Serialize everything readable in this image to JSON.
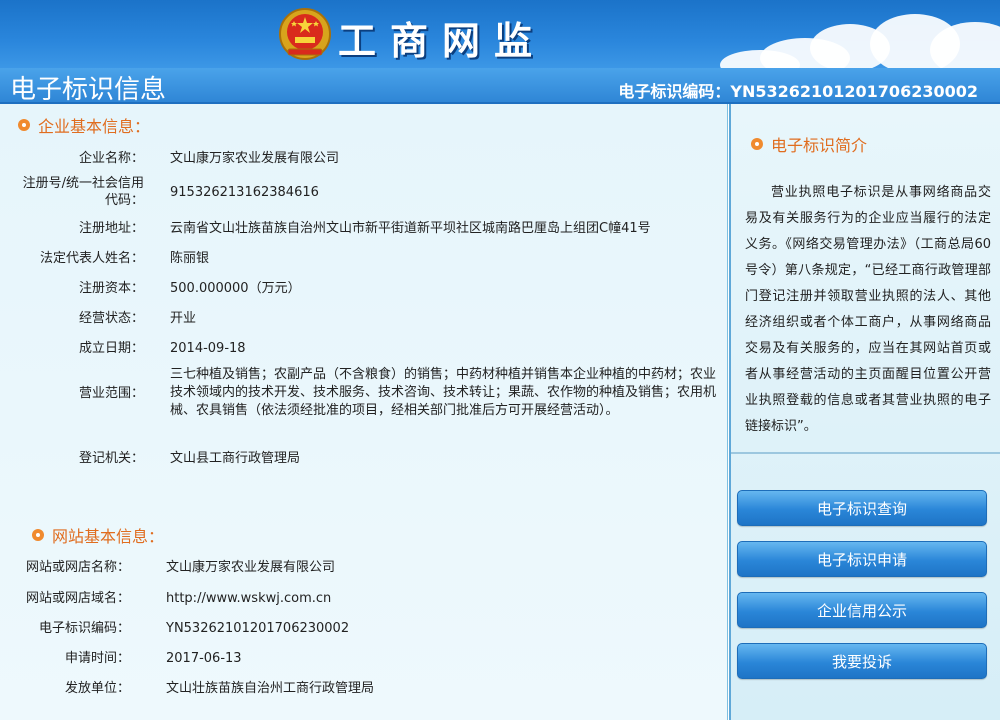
{
  "header": {
    "brand": "工商网监"
  },
  "titlebar": {
    "title": "电子标识信息",
    "code_text": "电子标识编码：YN53262101201706230002"
  },
  "enterprise": {
    "heading": "企业基本信息：",
    "rows": [
      {
        "label": "企业名称：",
        "value": "文山康万家农业发展有限公司"
      },
      {
        "label": "注册号/统一社会信用代码：",
        "value": "915326213162384616"
      },
      {
        "label": "注册地址：",
        "value": "云南省文山壮族苗族自治州文山市新平街道新平坝社区城南路巴厘岛上组团C幢41号"
      },
      {
        "label": "法定代表人姓名：",
        "value": "陈丽银"
      },
      {
        "label": "注册资本：",
        "value": "500.000000（万元）"
      },
      {
        "label": "经营状态：",
        "value": "开业"
      },
      {
        "label": "成立日期：",
        "value": "2014-09-18"
      },
      {
        "label": "营业范围：",
        "value": "三七种植及销售；农副产品（不含粮食）的销售；中药材种植并销售本企业种植的中药材；农业技术领域内的技术开发、技术服务、技术咨询、技术转让；果蔬、农作物的种植及销售；农用机械、农具销售（依法须经批准的项目，经相关部门批准后方可开展经营活动）。"
      },
      {
        "label": "登记机关：",
        "value": "文山县工商行政管理局"
      }
    ]
  },
  "website": {
    "heading": "网站基本信息：",
    "rows": [
      {
        "label": "网站或网店名称：",
        "value": "文山康万家农业发展有限公司"
      },
      {
        "label": "网站或网店域名：",
        "value": "http://www.wskwj.com.cn"
      },
      {
        "label": "电子标识编码：",
        "value": "YN53262101201706230002"
      },
      {
        "label": "申请时间：",
        "value": "2017-06-13"
      },
      {
        "label": "发放单位：",
        "value": "文山壮族苗族自治州工商行政管理局"
      }
    ]
  },
  "sidebar": {
    "heading": "电子标识简介",
    "intro": "营业执照电子标识是从事网络商品交易及有关服务行为的企业应当履行的法定义务。《网络交易管理办法》（工商总局60号令）第八条规定，“已经工商行政管理部门登记注册并领取营业执照的法人、其他经济组织或者个体工商户，从事网络商品交易及有关服务的，应当在其网站首页或者从事经营活动的主页面醒目位置公开营业执照登载的信息或者其营业执照的电子链接标识”。",
    "buttons": [
      {
        "label": "电子标识查询"
      },
      {
        "label": "电子标识申请"
      },
      {
        "label": "企业信用公示"
      },
      {
        "label": "我要投诉"
      }
    ]
  },
  "colors": {
    "accent": "#e06d1f",
    "header_blue": "#1b73c9",
    "button_blue": "#2a86d8"
  }
}
